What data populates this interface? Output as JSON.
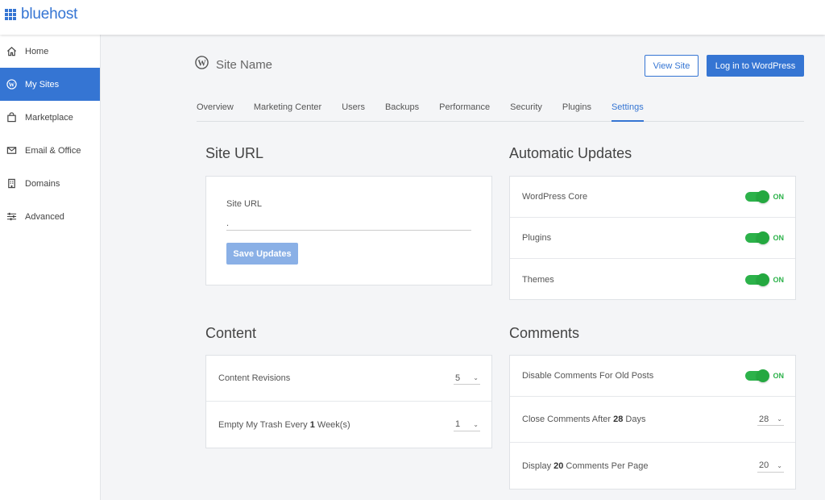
{
  "brand": {
    "name": "bluehost"
  },
  "sidebar": {
    "items": [
      {
        "label": "Home",
        "icon": "home-icon"
      },
      {
        "label": "My Sites",
        "icon": "wordpress-icon",
        "active": true
      },
      {
        "label": "Marketplace",
        "icon": "bag-icon"
      },
      {
        "label": "Email & Office",
        "icon": "mail-icon"
      },
      {
        "label": "Domains",
        "icon": "building-icon"
      },
      {
        "label": "Advanced",
        "icon": "sliders-icon"
      }
    ]
  },
  "header": {
    "site_name": "Site Name",
    "view_site": "View Site",
    "login_wp": "Log in to WordPress"
  },
  "tabs": [
    "Overview",
    "Marketing Center",
    "Users",
    "Backups",
    "Performance",
    "Security",
    "Plugins",
    "Settings"
  ],
  "active_tab": "Settings",
  "site_url": {
    "title": "Site URL",
    "label": "Site URL",
    "value": ".",
    "save": "Save Updates"
  },
  "automatic_updates": {
    "title": "Automatic Updates",
    "rows": [
      {
        "label": "WordPress Core",
        "state": "ON"
      },
      {
        "label": "Plugins",
        "state": "ON"
      },
      {
        "label": "Themes",
        "state": "ON"
      }
    ]
  },
  "content": {
    "title": "Content",
    "revisions_label": "Content Revisions",
    "revisions_value": "5",
    "trash_pre": "Empty My Trash Every ",
    "trash_num": "1",
    "trash_post": " Week(s)",
    "trash_value": "1"
  },
  "comments": {
    "title": "Comments",
    "disable_label": "Disable Comments For Old Posts",
    "disable_state": "ON",
    "close_pre": "Close Comments After ",
    "close_num": "28",
    "close_post": " Days",
    "close_value": "28",
    "display_pre": "Display ",
    "display_num": "20",
    "display_post": " Comments Per Page",
    "display_value": "20"
  },
  "colors": {
    "brand": "#3575d3",
    "toggle_on": "#2cb24a"
  }
}
